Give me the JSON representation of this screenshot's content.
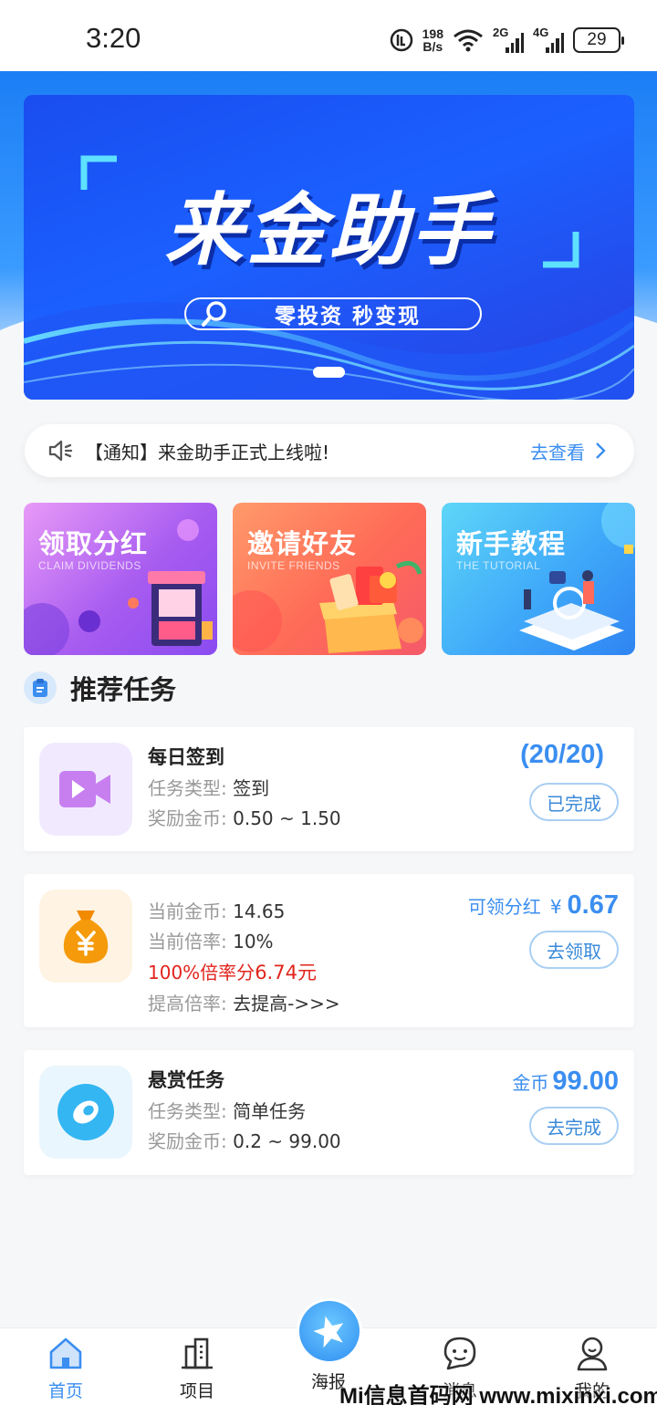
{
  "status_bar": {
    "time": "3:20",
    "net_speed_value": "198",
    "net_speed_unit": "B/s",
    "signal_2g_label": "2G",
    "signal_4g_label": "4G",
    "battery": "29"
  },
  "banner": {
    "title": "来金助手",
    "slogan": "零投资 秒变现"
  },
  "notice": {
    "text": "【通知】来金助手正式上线啦!",
    "link": "去查看"
  },
  "features": [
    {
      "title": "领取分红",
      "subtitle": "CLAIM DIVIDENDS"
    },
    {
      "title": "邀请好友",
      "subtitle": "INVITE FRIENDS"
    },
    {
      "title": "新手教程",
      "subtitle": "THE TUTORIAL"
    }
  ],
  "section": {
    "title": "推荐任务"
  },
  "tasks": {
    "daily": {
      "name": "每日签到",
      "type_label": "任务类型:",
      "type_value": "签到",
      "reward_label": "奖励金币:",
      "reward_value": "0.50 ~ 1.50",
      "progress": "(20/20)",
      "button": "已完成"
    },
    "dividend": {
      "coins_label": "当前金币:",
      "coins_value": "14.65",
      "rate_label": "当前倍率:",
      "rate_value": "10%",
      "promo_prefix": "100%倍率分",
      "promo_amount": "6.74元",
      "raise_label": "提高倍率:",
      "raise_value": "去提高->>>",
      "claim_label": "可领分红",
      "currency": "¥",
      "claim_amount": "0.67",
      "button": "去领取"
    },
    "bounty": {
      "name": "悬赏任务",
      "type_label": "任务类型:",
      "type_value": "简单任务",
      "reward_label": "奖励金币:",
      "reward_value": "0.2 ~ 99.00",
      "coin_label": "金币",
      "coin_amount": "99.00",
      "button": "去完成"
    }
  },
  "tabbar": {
    "home": "首页",
    "projects": "项目",
    "poster": "海报",
    "messages": "消息",
    "mine": "我的"
  },
  "watermark": "Mi信息首码网 www.mixinxi.com",
  "colors": {
    "accent": "#3b8ef0",
    "banner_blue": "#1b60ff",
    "promo_red": "#e1241c"
  }
}
